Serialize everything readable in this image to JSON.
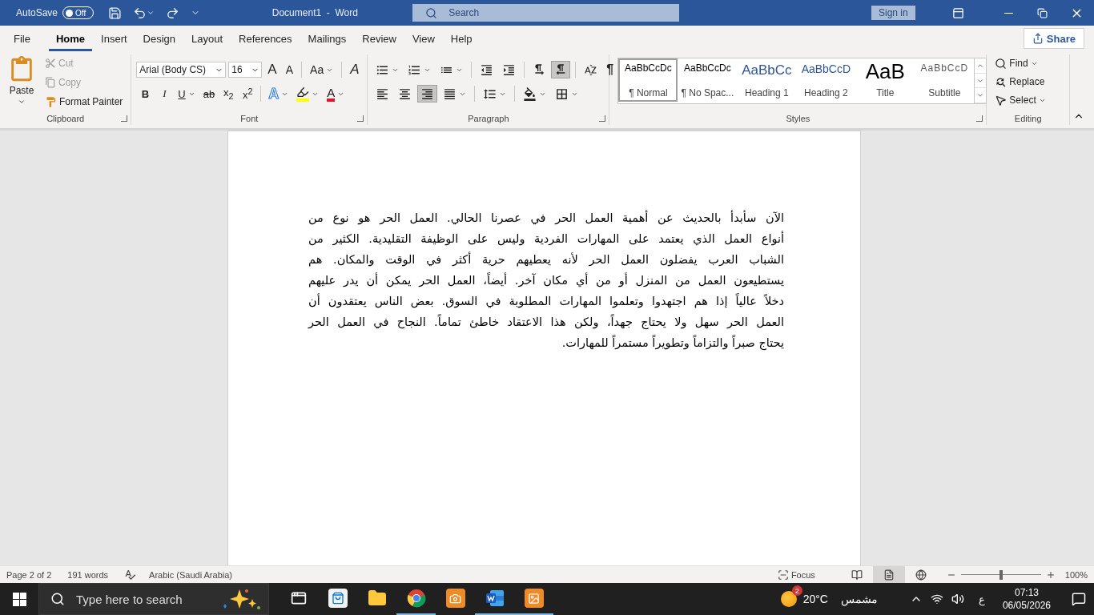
{
  "title_bar": {
    "autosave_label": "AutoSave",
    "autosave": {
      "on": false,
      "label": "Off"
    },
    "title": "Document1  -  Word",
    "search_placeholder": "Search",
    "sign_in": "Sign in"
  },
  "tabs": [
    {
      "label": "File",
      "selected": false
    },
    {
      "label": "Home",
      "selected": true
    },
    {
      "label": "Insert",
      "selected": false
    },
    {
      "label": "Design",
      "selected": false
    },
    {
      "label": "Layout",
      "selected": false
    },
    {
      "label": "References",
      "selected": false
    },
    {
      "label": "Mailings",
      "selected": false
    },
    {
      "label": "Review",
      "selected": false
    },
    {
      "label": "View",
      "selected": false
    },
    {
      "label": "Help",
      "selected": false
    }
  ],
  "share": "Share",
  "clipboard": {
    "group": "Clipboard",
    "paste": "Paste",
    "cut": {
      "label": "Cut",
      "disabled": true
    },
    "copy": {
      "label": "Copy",
      "disabled": true
    },
    "format_painter": "Format Painter"
  },
  "font": {
    "group": "Font",
    "name": "Arial (Body CS)",
    "size": "16",
    "tools": [
      {
        "kind": "grow",
        "label": "A"
      },
      {
        "kind": "shrink",
        "label": "A"
      },
      {
        "kind": "case",
        "label": "Aa"
      },
      {
        "kind": "clear",
        "label": "A"
      }
    ],
    "buttons": [
      {
        "kind": "bold",
        "label": "B"
      },
      {
        "kind": "italic",
        "label": "I"
      },
      {
        "kind": "underline",
        "label": "U"
      },
      {
        "kind": "strike",
        "label": "ab"
      },
      {
        "kind": "subscript",
        "label": "x$_{2}$"
      },
      {
        "kind": "superscript",
        "label": "x$^{2}$"
      }
    ],
    "effects_label": "A",
    "color_label": "A"
  },
  "paragraph": {
    "group": "Paragraph",
    "lists": [
      {
        "kind": "bullets"
      },
      {
        "kind": "numbering"
      },
      {
        "kind": "multilevel"
      }
    ],
    "direction": [
      {
        "kind": "ltr",
        "selected": false
      },
      {
        "kind": "rtl",
        "selected": true
      }
    ],
    "show_marks": "¶",
    "alignment": [
      {
        "kind": "left",
        "selected": false
      },
      {
        "kind": "center",
        "selected": false
      },
      {
        "kind": "right",
        "selected": true
      },
      {
        "kind": "justify",
        "selected": false
      }
    ]
  },
  "styles": {
    "group": "Styles",
    "items": [
      {
        "kind": "normal",
        "preview": "AaBbCcDc",
        "label": "¶ Normal",
        "selected": true
      },
      {
        "kind": "normal",
        "preview": "AaBbCcDc",
        "label": "¶ No Spac...",
        "selected": false
      },
      {
        "kind": "heading1",
        "preview": "AaBbCc",
        "label": "Heading 1",
        "selected": false
      },
      {
        "kind": "heading2",
        "preview": "AaBbCcD",
        "label": "Heading 2",
        "selected": false
      },
      {
        "kind": "title",
        "preview": "AaB",
        "label": "Title",
        "selected": false
      },
      {
        "kind": "subtitle",
        "preview": "AaBbCcD",
        "label": "Subtitle",
        "selected": false
      }
    ]
  },
  "editing": {
    "group": "Editing",
    "items": [
      {
        "kind": "find",
        "label": "Find"
      },
      {
        "kind": "replace",
        "label": "Replace"
      },
      {
        "kind": "select",
        "label": "Select"
      }
    ]
  },
  "document": {
    "lines": [
      "الآن سأبدأ بالحديث عن أهمية العمل الحر في عصرنا الحالي. العمل الحر هو نوع من",
      "أنواع العمل الذي يعتمد على المهارات الفردية وليس على الوظيفة التقليدية. الكثير من",
      "الشباب العرب يفضلون العمل الحر لأنه يعطيهم حرية أكثر في الوقت والمكان. هم",
      "يستطيعون العمل من المنزل أو من أي مكان آخر. أيضاً، العمل الحر يمكن أن يدر عليهم",
      "دخلاً عالياً إذا هم اجتهدوا وتعلموا المهارات المطلوبة في السوق. بعض الناس يعتقدون أن",
      "العمل الحر سهل ولا يحتاج جهداً، ولكن هذا الاعتقاد خاطئ تماماً. النجاح في العمل الحر",
      "يحتاج صبراً والتزاماً وتطويراً مستمراً للمهارات."
    ]
  },
  "status_bar": {
    "page": "Page 2 of 2",
    "words": "191 words",
    "language": "Arabic (Saudi Arabia)",
    "focus": "Focus",
    "views": [
      {
        "kind": "read",
        "selected": false
      },
      {
        "kind": "print",
        "selected": true
      },
      {
        "kind": "web",
        "selected": false
      }
    ],
    "zoom": {
      "level": 0.5,
      "reading": "100%"
    }
  },
  "taskbar": {
    "search_placeholder": "Type here to search",
    "apps": [
      {
        "kind": "task_view",
        "running": false
      },
      {
        "kind": "store",
        "running": false
      },
      {
        "kind": "explorer",
        "running": false
      },
      {
        "kind": "chrome",
        "running": true
      },
      {
        "kind": "camera",
        "running": false
      },
      {
        "kind": "word",
        "running": true
      },
      {
        "kind": "image",
        "running": true
      }
    ],
    "weather": {
      "badge": "2",
      "temperature": "20°C",
      "condition": "مشمس"
    },
    "keyboard": "ع",
    "time": "07:13",
    "date": "06/05/2026"
  }
}
